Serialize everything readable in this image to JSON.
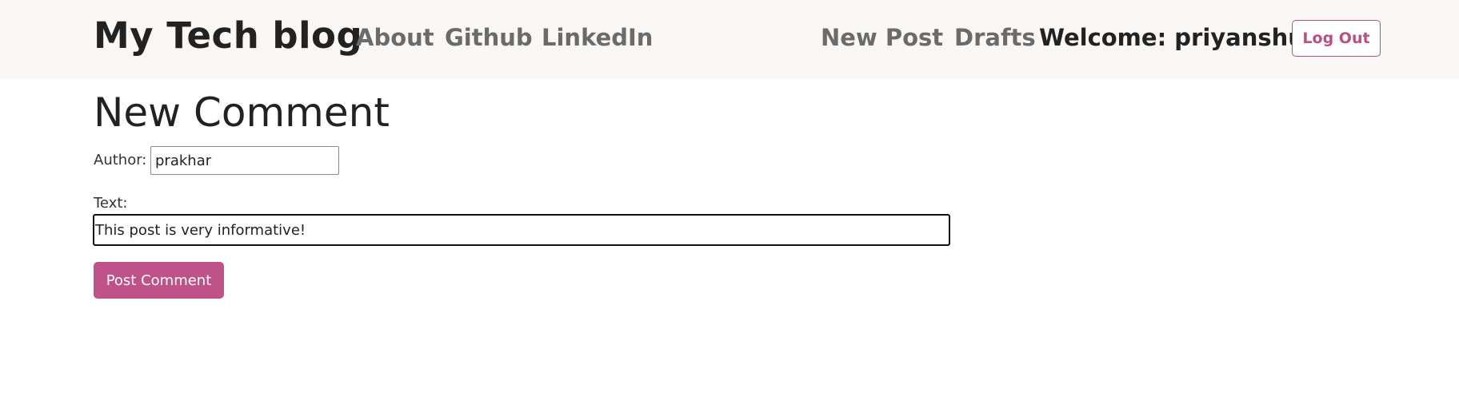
{
  "header": {
    "brand": "My Tech blog",
    "nav_left": [
      "About",
      "Github",
      "LinkedIn"
    ],
    "nav_right": [
      "New Post",
      "Drafts"
    ],
    "welcome": "Welcome: priyanshu",
    "logout_label": "Log Out"
  },
  "form": {
    "title": "New Comment",
    "author_label": "Author:",
    "author_value": "prakhar",
    "text_label": "Text:",
    "text_value": "This post is very informative!",
    "submit_label": "Post Comment"
  },
  "colors": {
    "accent": "#c0528a",
    "header_bg": "#f9f8f7",
    "nav_text": "#6b6b6b"
  }
}
